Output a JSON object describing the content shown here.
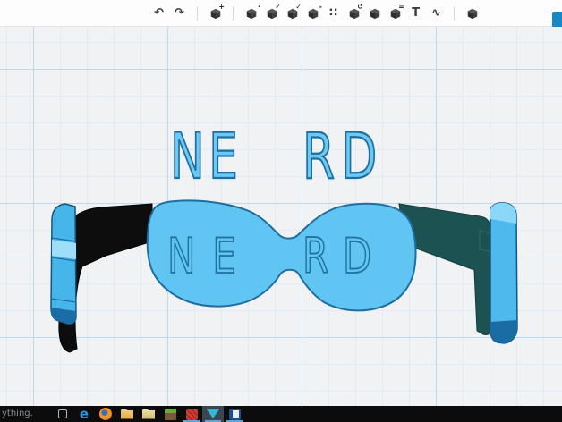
{
  "app": {
    "title": "3D design workspace"
  },
  "toolbar": {
    "items": [
      {
        "name": "undo",
        "glyph": "↶"
      },
      {
        "name": "redo",
        "glyph": "↷"
      },
      {
        "name": "transform",
        "mod": "+"
      },
      {
        "name": "primitives",
        "mod": "·"
      },
      {
        "name": "sketch",
        "mod": "✓"
      },
      {
        "name": "construct",
        "mod": "✓"
      },
      {
        "name": "modify",
        "mod": "-"
      },
      {
        "name": "pattern",
        "glyph": "∷"
      },
      {
        "name": "grouping",
        "mod": "↺"
      },
      {
        "name": "combine",
        "mod": ""
      },
      {
        "name": "measure",
        "mod": "="
      },
      {
        "name": "text",
        "glyph": "T"
      },
      {
        "name": "snap",
        "glyph": "∿"
      },
      {
        "name": "materials",
        "mod": ""
      }
    ],
    "right_button_color": "#1787c5"
  },
  "model": {
    "floating_text": {
      "left": "NE",
      "right": "RD"
    },
    "engraved_text": {
      "left": "NE",
      "right": "RD"
    },
    "colors": {
      "frame": "#60c5f2",
      "outline": "#1f6e9d",
      "left_temple": "#0d0d0d",
      "right_temple": "#1d5252",
      "temple_tip": "#49b8ec",
      "tip_highlight": "#9fdef9"
    }
  },
  "canvas": {
    "background": "#f1f2f4",
    "grid_major_color": "#bed8ec",
    "grid_minor_color": "#e0ebf6"
  },
  "taskbar": {
    "search_text": "ything.",
    "edge_glyph": "e",
    "icons": [
      {
        "name": "task-view"
      },
      {
        "name": "edge-browser"
      },
      {
        "name": "firefox-browser"
      },
      {
        "name": "file-explorer"
      },
      {
        "name": "documents-folder"
      },
      {
        "name": "minecraft"
      },
      {
        "name": "red-app",
        "open": true
      },
      {
        "name": "cad-app",
        "open": true,
        "active": true
      },
      {
        "name": "blue-app",
        "open": true
      }
    ]
  }
}
